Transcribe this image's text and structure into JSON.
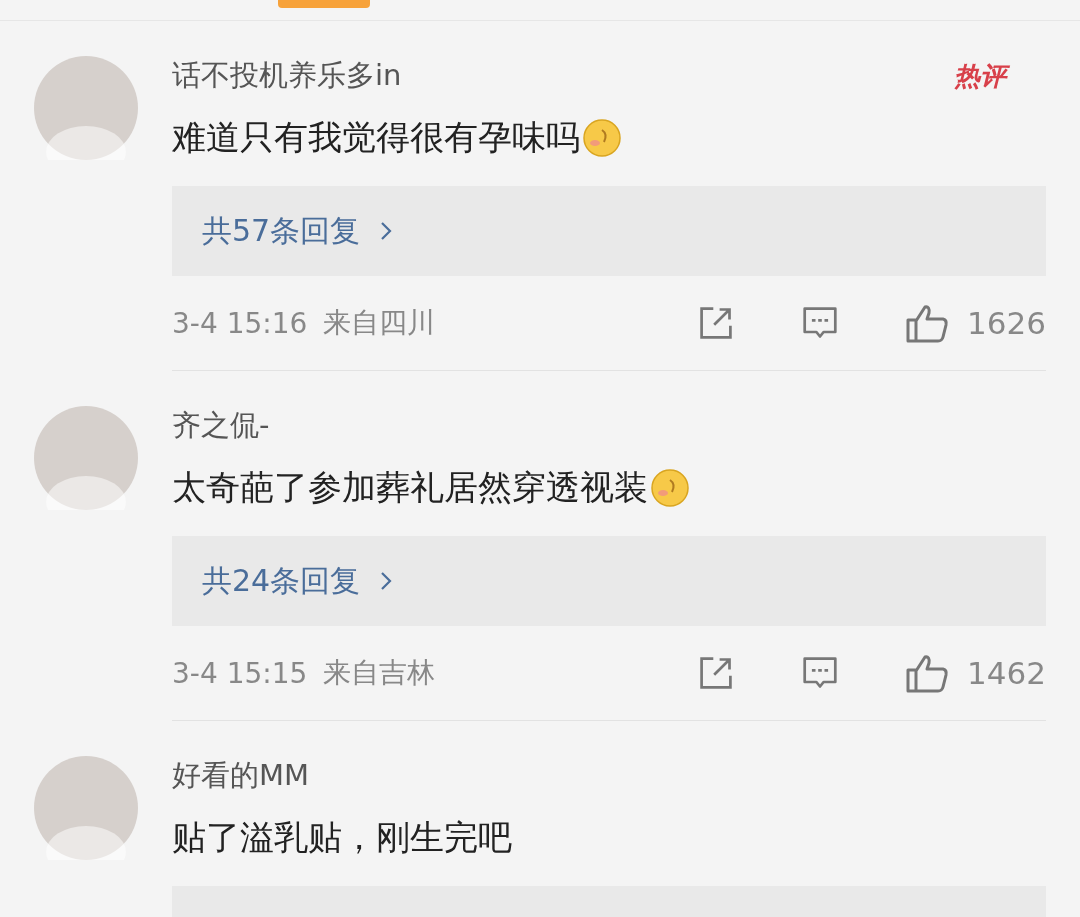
{
  "comments": [
    {
      "name": "话不投机养乐多in",
      "badge": "热评",
      "text": "难道只有我觉得很有孕味吗",
      "emoji": true,
      "replies": "共57条回复",
      "time": "3-4 15:16",
      "location": "来自四川",
      "likes": "1626"
    },
    {
      "name": "齐之侃-",
      "text": "太奇葩了参加葬礼居然穿透视装",
      "emoji": true,
      "replies": "共24条回复",
      "time": "3-4 15:15",
      "location": "来自吉林",
      "likes": "1462"
    },
    {
      "name": "好看的MM",
      "text": "贴了溢乳贴，刚生完吧",
      "emoji": false
    }
  ]
}
